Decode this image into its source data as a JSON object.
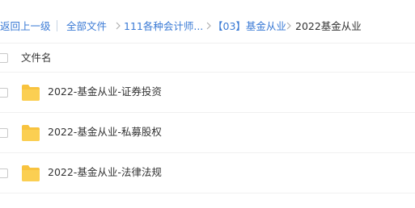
{
  "breadcrumb": {
    "back": "返回上一级",
    "all_files": "全部文件",
    "level1": "111各种会计师...",
    "level2": "【03】基金从业",
    "current": "2022基金从业"
  },
  "list": {
    "header_label": "文件名",
    "items": [
      {
        "name": "2022-基金从业-证券投资",
        "icon": "folder-icon"
      },
      {
        "name": "2022-基金从业-私募股权",
        "icon": "folder-icon"
      },
      {
        "name": "2022-基金从业-法律法规",
        "icon": "folder-icon"
      }
    ]
  },
  "colors": {
    "link": "#3a7ad5",
    "folder": "#f8c33f",
    "text": "#333333",
    "divider": "#f0f0f0"
  }
}
